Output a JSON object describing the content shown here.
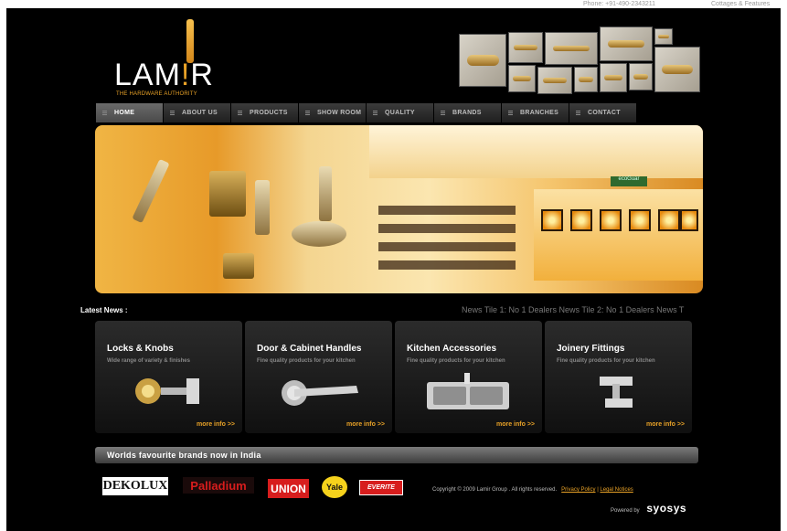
{
  "top": {
    "phone": "Phone: +91-490-2343211",
    "cottages": "Cottages & Features"
  },
  "logo": {
    "text_left": "LAM",
    "text_bang": "!",
    "text_right": "R",
    "tagline": "THE HARDWARE AUTHORITY"
  },
  "nav": {
    "items": [
      {
        "label": "HOME",
        "active": true
      },
      {
        "label": "ABOUT US"
      },
      {
        "label": "PRODUCTS"
      },
      {
        "label": "SHOW ROOM"
      },
      {
        "label": "QUALITY"
      },
      {
        "label": "BRANDS"
      },
      {
        "label": "BRANCHES"
      },
      {
        "label": "CONTACT"
      }
    ]
  },
  "banner": {
    "sign_text": "ecoGuar"
  },
  "news": {
    "label": "Latest News :",
    "ticker": "News Tile 1: No 1 Dealers News Tile 2: No 1 Dealers News T"
  },
  "products": [
    {
      "title": "Locks & Knobs",
      "subtitle": "Wide range of variety & finishes",
      "more": "more info >>",
      "icon": "lock-knob-icon"
    },
    {
      "title": "Door & Cabinet Handles",
      "subtitle": "Fine quality products for your kitchen",
      "more": "more info >>",
      "icon": "door-handle-icon"
    },
    {
      "title": "Kitchen Accessories",
      "subtitle": "Fine quality products for your kitchen",
      "more": "more info >>",
      "icon": "kitchen-sink-icon"
    },
    {
      "title": "Joinery Fittings",
      "subtitle": "Fine quality products for your kitchen",
      "more": "more info >>",
      "icon": "hinge-fitting-icon"
    }
  ],
  "brands": {
    "heading": "Worlds favourite brands now in India",
    "items": [
      "DEKOLUX",
      "Palladium",
      "UNION",
      "Yale",
      "EVERITE"
    ]
  },
  "footer": {
    "copyright": "Copyright © 2009 Lamir Group . All rights reserved.",
    "privacy": "Privacy Policy",
    "separator": "|",
    "legal": "Legal Notices",
    "powered_by": "Powered by",
    "powered_brand": "syosys"
  },
  "colors": {
    "accent": "#e9a227",
    "background": "#000000",
    "brand_red": "#d71d1d"
  }
}
